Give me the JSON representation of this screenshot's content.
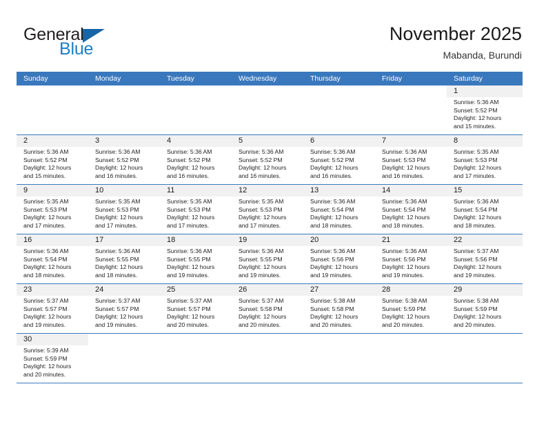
{
  "brand": {
    "name_part1": "General",
    "name_part2": "Blue",
    "flag_icon": "triangle-flag-icon"
  },
  "header": {
    "title": "November 2025",
    "subtitle": "Mabanda, Burundi"
  },
  "calendar": {
    "weekday_headers": [
      "Sunday",
      "Monday",
      "Tuesday",
      "Wednesday",
      "Thursday",
      "Friday",
      "Saturday"
    ],
    "accent_color": "#3a78bd",
    "daynum_strip_color": "#f1f1f1",
    "weeks": [
      [
        {
          "day": "",
          "empty": true
        },
        {
          "day": "",
          "empty": true
        },
        {
          "day": "",
          "empty": true
        },
        {
          "day": "",
          "empty": true
        },
        {
          "day": "",
          "empty": true
        },
        {
          "day": "",
          "empty": true
        },
        {
          "day": "1",
          "sunrise": "Sunrise: 5:36 AM",
          "sunset": "Sunset: 5:52 PM",
          "daylight1": "Daylight: 12 hours",
          "daylight2": "and 15 minutes."
        }
      ],
      [
        {
          "day": "2",
          "sunrise": "Sunrise: 5:36 AM",
          "sunset": "Sunset: 5:52 PM",
          "daylight1": "Daylight: 12 hours",
          "daylight2": "and 15 minutes."
        },
        {
          "day": "3",
          "sunrise": "Sunrise: 5:36 AM",
          "sunset": "Sunset: 5:52 PM",
          "daylight1": "Daylight: 12 hours",
          "daylight2": "and 16 minutes."
        },
        {
          "day": "4",
          "sunrise": "Sunrise: 5:36 AM",
          "sunset": "Sunset: 5:52 PM",
          "daylight1": "Daylight: 12 hours",
          "daylight2": "and 16 minutes."
        },
        {
          "day": "5",
          "sunrise": "Sunrise: 5:36 AM",
          "sunset": "Sunset: 5:52 PM",
          "daylight1": "Daylight: 12 hours",
          "daylight2": "and 16 minutes."
        },
        {
          "day": "6",
          "sunrise": "Sunrise: 5:36 AM",
          "sunset": "Sunset: 5:52 PM",
          "daylight1": "Daylight: 12 hours",
          "daylight2": "and 16 minutes."
        },
        {
          "day": "7",
          "sunrise": "Sunrise: 5:36 AM",
          "sunset": "Sunset: 5:53 PM",
          "daylight1": "Daylight: 12 hours",
          "daylight2": "and 16 minutes."
        },
        {
          "day": "8",
          "sunrise": "Sunrise: 5:35 AM",
          "sunset": "Sunset: 5:53 PM",
          "daylight1": "Daylight: 12 hours",
          "daylight2": "and 17 minutes."
        }
      ],
      [
        {
          "day": "9",
          "sunrise": "Sunrise: 5:35 AM",
          "sunset": "Sunset: 5:53 PM",
          "daylight1": "Daylight: 12 hours",
          "daylight2": "and 17 minutes."
        },
        {
          "day": "10",
          "sunrise": "Sunrise: 5:35 AM",
          "sunset": "Sunset: 5:53 PM",
          "daylight1": "Daylight: 12 hours",
          "daylight2": "and 17 minutes."
        },
        {
          "day": "11",
          "sunrise": "Sunrise: 5:35 AM",
          "sunset": "Sunset: 5:53 PM",
          "daylight1": "Daylight: 12 hours",
          "daylight2": "and 17 minutes."
        },
        {
          "day": "12",
          "sunrise": "Sunrise: 5:35 AM",
          "sunset": "Sunset: 5:53 PM",
          "daylight1": "Daylight: 12 hours",
          "daylight2": "and 17 minutes."
        },
        {
          "day": "13",
          "sunrise": "Sunrise: 5:36 AM",
          "sunset": "Sunset: 5:54 PM",
          "daylight1": "Daylight: 12 hours",
          "daylight2": "and 18 minutes."
        },
        {
          "day": "14",
          "sunrise": "Sunrise: 5:36 AM",
          "sunset": "Sunset: 5:54 PM",
          "daylight1": "Daylight: 12 hours",
          "daylight2": "and 18 minutes."
        },
        {
          "day": "15",
          "sunrise": "Sunrise: 5:36 AM",
          "sunset": "Sunset: 5:54 PM",
          "daylight1": "Daylight: 12 hours",
          "daylight2": "and 18 minutes."
        }
      ],
      [
        {
          "day": "16",
          "sunrise": "Sunrise: 5:36 AM",
          "sunset": "Sunset: 5:54 PM",
          "daylight1": "Daylight: 12 hours",
          "daylight2": "and 18 minutes."
        },
        {
          "day": "17",
          "sunrise": "Sunrise: 5:36 AM",
          "sunset": "Sunset: 5:55 PM",
          "daylight1": "Daylight: 12 hours",
          "daylight2": "and 18 minutes."
        },
        {
          "day": "18",
          "sunrise": "Sunrise: 5:36 AM",
          "sunset": "Sunset: 5:55 PM",
          "daylight1": "Daylight: 12 hours",
          "daylight2": "and 19 minutes."
        },
        {
          "day": "19",
          "sunrise": "Sunrise: 5:36 AM",
          "sunset": "Sunset: 5:55 PM",
          "daylight1": "Daylight: 12 hours",
          "daylight2": "and 19 minutes."
        },
        {
          "day": "20",
          "sunrise": "Sunrise: 5:36 AM",
          "sunset": "Sunset: 5:56 PM",
          "daylight1": "Daylight: 12 hours",
          "daylight2": "and 19 minutes."
        },
        {
          "day": "21",
          "sunrise": "Sunrise: 5:36 AM",
          "sunset": "Sunset: 5:56 PM",
          "daylight1": "Daylight: 12 hours",
          "daylight2": "and 19 minutes."
        },
        {
          "day": "22",
          "sunrise": "Sunrise: 5:37 AM",
          "sunset": "Sunset: 5:56 PM",
          "daylight1": "Daylight: 12 hours",
          "daylight2": "and 19 minutes."
        }
      ],
      [
        {
          "day": "23",
          "sunrise": "Sunrise: 5:37 AM",
          "sunset": "Sunset: 5:57 PM",
          "daylight1": "Daylight: 12 hours",
          "daylight2": "and 19 minutes."
        },
        {
          "day": "24",
          "sunrise": "Sunrise: 5:37 AM",
          "sunset": "Sunset: 5:57 PM",
          "daylight1": "Daylight: 12 hours",
          "daylight2": "and 19 minutes."
        },
        {
          "day": "25",
          "sunrise": "Sunrise: 5:37 AM",
          "sunset": "Sunset: 5:57 PM",
          "daylight1": "Daylight: 12 hours",
          "daylight2": "and 20 minutes."
        },
        {
          "day": "26",
          "sunrise": "Sunrise: 5:37 AM",
          "sunset": "Sunset: 5:58 PM",
          "daylight1": "Daylight: 12 hours",
          "daylight2": "and 20 minutes."
        },
        {
          "day": "27",
          "sunrise": "Sunrise: 5:38 AM",
          "sunset": "Sunset: 5:58 PM",
          "daylight1": "Daylight: 12 hours",
          "daylight2": "and 20 minutes."
        },
        {
          "day": "28",
          "sunrise": "Sunrise: 5:38 AM",
          "sunset": "Sunset: 5:59 PM",
          "daylight1": "Daylight: 12 hours",
          "daylight2": "and 20 minutes."
        },
        {
          "day": "29",
          "sunrise": "Sunrise: 5:38 AM",
          "sunset": "Sunset: 5:59 PM",
          "daylight1": "Daylight: 12 hours",
          "daylight2": "and 20 minutes."
        }
      ],
      [
        {
          "day": "30",
          "sunrise": "Sunrise: 5:39 AM",
          "sunset": "Sunset: 5:59 PM",
          "daylight1": "Daylight: 12 hours",
          "daylight2": "and 20 minutes."
        },
        {
          "day": "",
          "empty": true
        },
        {
          "day": "",
          "empty": true
        },
        {
          "day": "",
          "empty": true
        },
        {
          "day": "",
          "empty": true
        },
        {
          "day": "",
          "empty": true
        },
        {
          "day": "",
          "empty": true
        }
      ]
    ]
  }
}
